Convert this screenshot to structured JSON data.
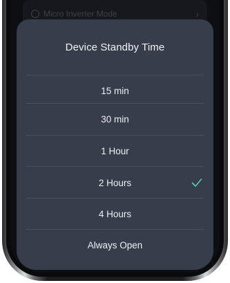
{
  "background_row": {
    "label": "Micro Inverter Mode"
  },
  "sheet": {
    "title": "Device Standby Time",
    "options": [
      {
        "label": "15 min",
        "selected": false
      },
      {
        "label": "30 min",
        "selected": false
      },
      {
        "label": "1 Hour",
        "selected": false
      },
      {
        "label": "2 Hours",
        "selected": true
      },
      {
        "label": "4 Hours",
        "selected": false
      },
      {
        "label": "Always Open",
        "selected": false
      }
    ]
  },
  "colors": {
    "sheet_bg": "#383d4c",
    "divider": "#4a5061",
    "check": "#4fd3a3",
    "text": "#eef0f3"
  }
}
